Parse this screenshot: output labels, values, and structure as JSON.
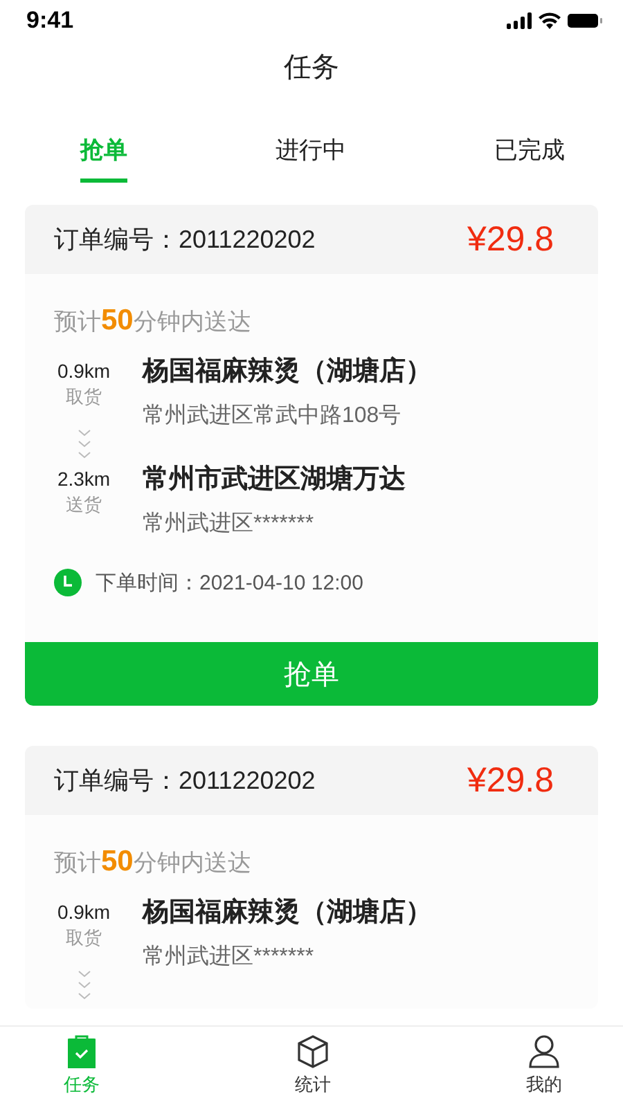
{
  "status_bar": {
    "time": "9:41"
  },
  "title": "任务",
  "tabs": [
    {
      "label": "抢单",
      "selected": true
    },
    {
      "label": "进行中",
      "selected": false
    },
    {
      "label": "已完成",
      "selected": false
    }
  ],
  "orders": [
    {
      "order_label": "订单编号：",
      "order_no": "2011220202",
      "price": "¥29.8",
      "eta": {
        "prefix": "预计",
        "minutes": "50",
        "suffix": "分钟内送达"
      },
      "stops": [
        {
          "kind": "pickup",
          "distance": "0.9km",
          "action": "取货",
          "name": "杨国福麻辣烫（湖塘店）",
          "address": "常州武进区常武中路108号"
        },
        {
          "kind": "dropoff",
          "distance": "2.3km",
          "action": "送货",
          "name": "常州市武进区湖塘万达",
          "address": "常州武进区*******"
        }
      ],
      "time_label": "下单时间：",
      "time": "2021-04-10 12:00",
      "button": "抢单"
    },
    {
      "order_label": "订单编号：",
      "order_no": "2011220202",
      "price": "¥29.8",
      "eta": {
        "prefix": "预计",
        "minutes": "50",
        "suffix": "分钟内送达"
      },
      "stops": [
        {
          "kind": "pickup",
          "distance": "0.9km",
          "action": "取货",
          "name": "杨国福麻辣烫（湖塘店）",
          "address": "常州武进区*******"
        }
      ]
    }
  ],
  "bottom_nav": [
    {
      "kind": "tasks",
      "label": "任务",
      "selected": true
    },
    {
      "kind": "stats",
      "label": "统计",
      "selected": false
    },
    {
      "kind": "profile",
      "label": "我的",
      "selected": false
    }
  ]
}
